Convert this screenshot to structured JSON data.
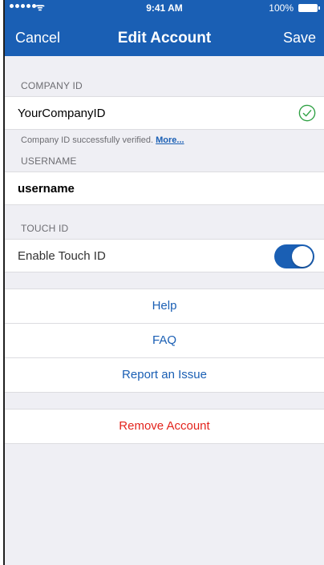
{
  "status_bar": {
    "time": "9:41 AM",
    "battery": "100%",
    "icons": [
      "signal-dots-icon",
      "wifi-icon",
      "battery-icon"
    ]
  },
  "nav": {
    "cancel": "Cancel",
    "title": "Edit Account",
    "save": "Save"
  },
  "company": {
    "header": "COMPANY ID",
    "value": "YourCompanyID",
    "status_icon": "checkmark-circle-icon",
    "note": "Company ID successfully verified.",
    "more_link": "More..."
  },
  "username": {
    "header": "USERNAME",
    "value": "username"
  },
  "touch_id": {
    "header": "TOUCH ID",
    "label": "Enable Touch ID",
    "enabled": true
  },
  "links": [
    "Help",
    "FAQ",
    "Report an Issue"
  ],
  "remove": "Remove Account",
  "colors": {
    "brand": "#1a5fb4",
    "success": "#2ea043",
    "destructive": "#e3231c"
  }
}
